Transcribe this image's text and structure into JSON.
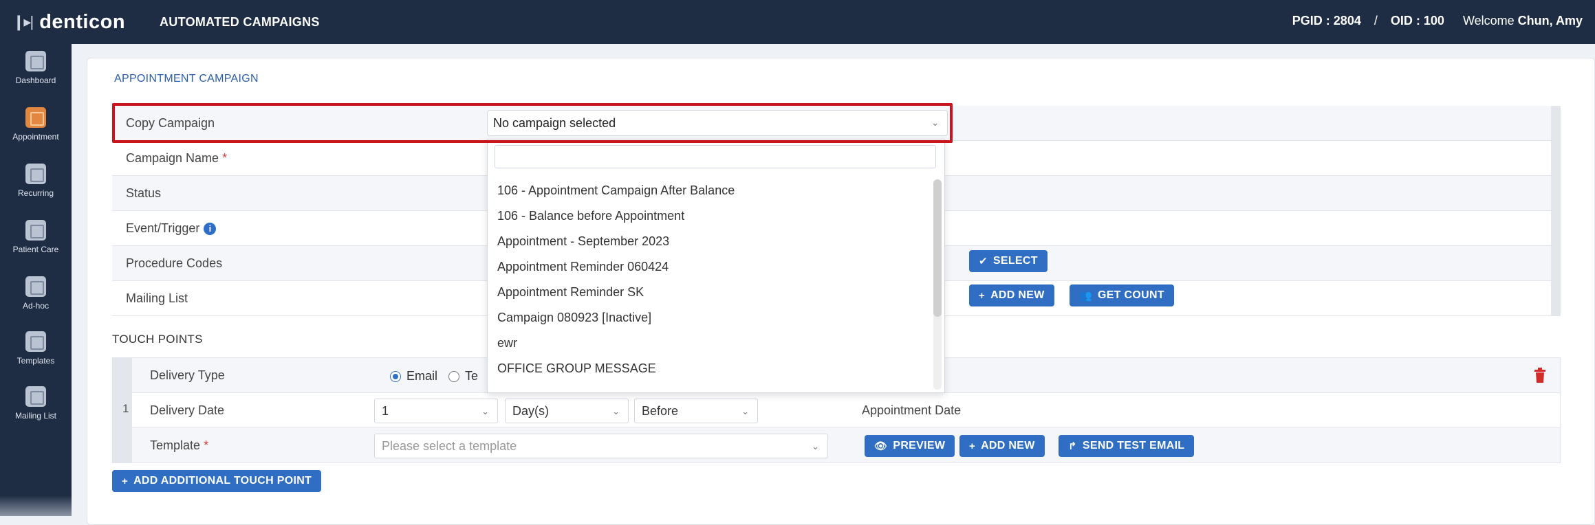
{
  "header": {
    "logo_text": "denticon",
    "app_title": "AUTOMATED CAMPAIGNS",
    "pgid_label": "PGID : 2804",
    "separator": "/",
    "oid_label": "OID : 100",
    "welcome": "Welcome",
    "user_name": "Chun, Amy"
  },
  "sidebar": {
    "items": [
      {
        "label": "Dashboard",
        "icon": "dashboard-icon",
        "active": false
      },
      {
        "label": "Appointment",
        "icon": "appointment-icon",
        "active": true
      },
      {
        "label": "Recurring",
        "icon": "recurring-icon",
        "active": false
      },
      {
        "label": "Patient Care",
        "icon": "patient-care-icon",
        "active": false
      },
      {
        "label": "Ad-hoc",
        "icon": "adhoc-icon",
        "active": false
      },
      {
        "label": "Templates",
        "icon": "templates-icon",
        "active": false
      },
      {
        "label": "Mailing List",
        "icon": "mailing-list-icon",
        "active": false
      }
    ]
  },
  "main": {
    "section_title": "APPOINTMENT CAMPAIGN",
    "form": {
      "copy_campaign_label": "Copy Campaign",
      "copy_campaign_value": "No campaign selected",
      "campaign_name_label": "Campaign Name",
      "required_mark": "*",
      "status_label": "Status",
      "event_trigger_label": "Event/Trigger",
      "procedure_codes_label": "Procedure Codes",
      "mailing_list_label": "Mailing List",
      "select_button": "SELECT",
      "add_new_button": "ADD NEW",
      "get_count_button": "GET COUNT"
    },
    "dropdown": {
      "options": [
        "106 - Appointment Campaign After Balance",
        "106 - Balance before Appointment",
        "Appointment - September 2023",
        "Appointment Reminder 060424",
        "Appointment Reminder SK",
        "Campaign 080923 [Inactive]",
        "ewr",
        "OFFICE GROUP MESSAGE"
      ]
    },
    "touch_points": {
      "title": "TOUCH POINTS",
      "index": "1",
      "delivery_type_label": "Delivery Type",
      "email_option": "Email",
      "text_option_partial": "Te",
      "delivery_date_label": "Delivery Date",
      "delivery_number": "1",
      "delivery_unit": "Day(s)",
      "delivery_relation": "Before",
      "delivery_reference": "Appointment Date",
      "template_label": "Template",
      "template_placeholder": "Please select a template",
      "preview_button": "PREVIEW",
      "add_new_button": "ADD NEW",
      "send_test_email_button": "SEND TEST EMAIL"
    },
    "add_touch_point_button": "ADD ADDITIONAL TOUCH POINT"
  },
  "colors": {
    "header_bg": "#1f2d44",
    "accent_blue": "#2f6ec2",
    "highlight_red": "#c8161c",
    "active_icon": "#e2873f",
    "delete_red": "#d32a2a"
  }
}
